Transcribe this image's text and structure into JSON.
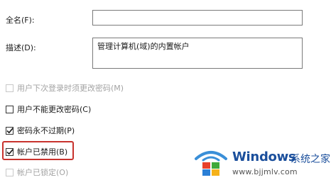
{
  "form": {
    "full_name_label": "全名(F):",
    "full_name_value": "",
    "description_label": "描述(D):",
    "description_value": "管理计算机(域)的内置帐户"
  },
  "options": [
    {
      "label": "用户下次登录时须更改密码(M)",
      "checked": false,
      "disabled": true
    },
    {
      "label": "用户不能更改密码(C)",
      "checked": false,
      "disabled": false
    },
    {
      "label": "密码永不过期(P)",
      "checked": true,
      "disabled": false
    },
    {
      "label": "帐户已禁用(B)",
      "checked": true,
      "disabled": false
    },
    {
      "label": "帐户已锁定(O)",
      "checked": false,
      "disabled": true
    }
  ],
  "highlight_color": "#c8322d",
  "watermark": {
    "brand": "Windows",
    "brand_cn": "系统之家",
    "url": "www.bjjmlv.com",
    "logo_icon": "windows-logo-icon",
    "brand_color": "#1b4f9c"
  }
}
